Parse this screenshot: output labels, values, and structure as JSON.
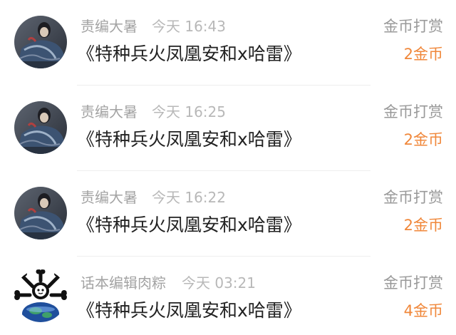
{
  "colors": {
    "accent": "#f0873a",
    "name_text": "#a3a3a3",
    "time_text": "#b8b8b8",
    "title_text": "#222222",
    "action_text": "#999999"
  },
  "messages": [
    {
      "avatar_icon": "character-portrait-avatar",
      "sender": "责编大暑",
      "time": "今天 16:43",
      "book_title": "《特种兵火凤凰安和x哈雷》",
      "action": "金币打赏",
      "amount": "2金币"
    },
    {
      "avatar_icon": "character-portrait-avatar",
      "sender": "责编大暑",
      "time": "今天 16:25",
      "book_title": "《特种兵火凤凰安和x哈雷》",
      "action": "金币打赏",
      "amount": "2金币"
    },
    {
      "avatar_icon": "character-portrait-avatar",
      "sender": "责编大暑",
      "time": "今天 16:22",
      "book_title": "《特种兵火凤凰安和x哈雷》",
      "action": "金币打赏",
      "amount": "2金币"
    },
    {
      "avatar_icon": "cartoon-planet-bones-avatar",
      "sender": "话本编辑肉粽",
      "time": "今天 03:21",
      "book_title": "《特种兵火凤凰安和x哈雷》",
      "action": "金币打赏",
      "amount": "4金币"
    }
  ]
}
